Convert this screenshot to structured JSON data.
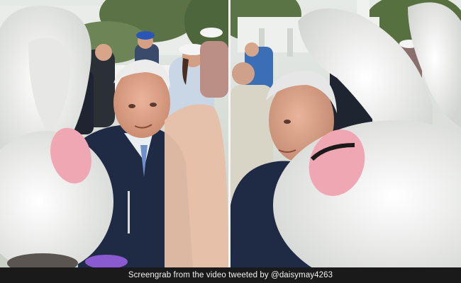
{
  "photo": {
    "left_panel_description_hidden": "",
    "caption": "Screengrab from the video tweeted by @daisymay4263"
  },
  "colors": {
    "sky": "#dfe6e4",
    "foliage": "#4f6b3e",
    "bunny_fur": "#eef0ee",
    "bunny_ear_inner": "#f0a7b4",
    "navy_jacket": "#1f2b44",
    "skin": "#e2a98e",
    "hair": "#e8e8e8",
    "caption_bar": "#1a1a1a"
  }
}
